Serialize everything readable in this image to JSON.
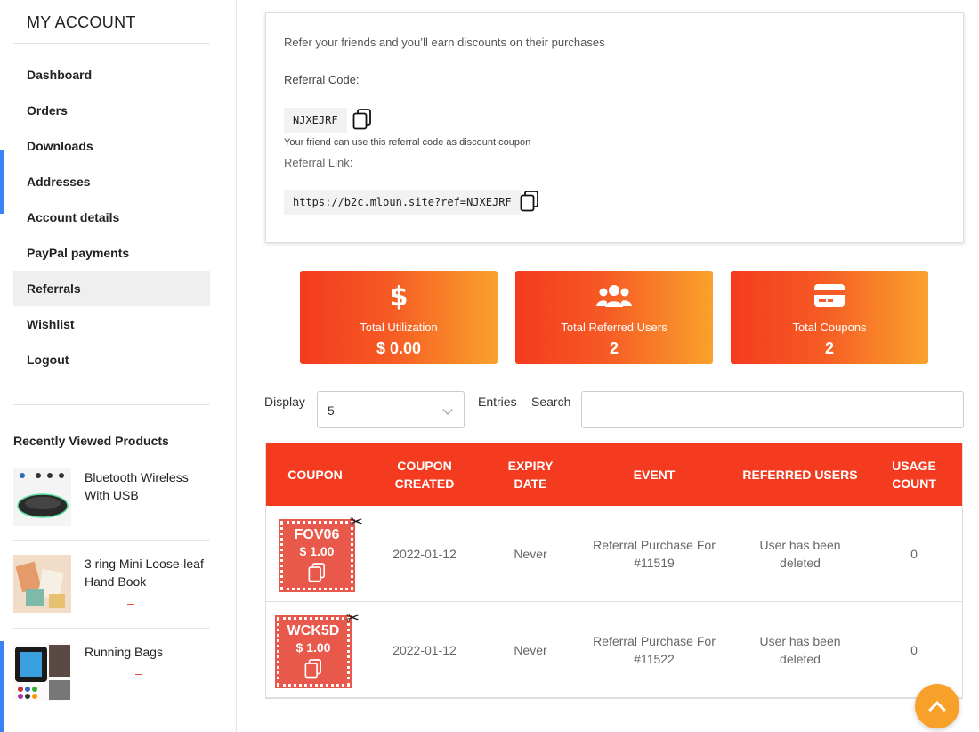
{
  "sidebar": {
    "title": "MY ACCOUNT",
    "menu": [
      "Dashboard",
      "Orders",
      "Downloads",
      "Addresses",
      "Account details",
      "PayPal payments",
      "Referrals",
      "Wishlist",
      "Logout"
    ],
    "active": "Referrals",
    "recently_viewed": {
      "title": "Recently Viewed Products",
      "items": [
        {
          "name": "Bluetooth Wireless With USB",
          "price": ""
        },
        {
          "name": "3 ring Mini Loose-leaf Hand Book",
          "price": "–"
        },
        {
          "name": "Running Bags",
          "price": "–"
        }
      ]
    }
  },
  "referral": {
    "intro": "Refer your friends and you’ll earn discounts on their purchases",
    "code_label": "Referral Code:",
    "code": "NJXEJRF",
    "code_hint": "Your friend can use this referral code as discount coupon",
    "link_label": "Referral Link:",
    "link": "https://b2c.mloun.site?ref=NJXEJRF"
  },
  "stats": [
    {
      "label": "Total Utilization",
      "value": "$ 0.00",
      "icon": "dollar-icon"
    },
    {
      "label": "Total Referred Users",
      "value": "2",
      "icon": "users-icon"
    },
    {
      "label": "Total Coupons",
      "value": "2",
      "icon": "credit-card-icon"
    }
  ],
  "controls": {
    "display_label": "Display",
    "display_value": "5",
    "entries_label": "Entries",
    "search_label": "Search",
    "search_value": ""
  },
  "table": {
    "headers": [
      "COUPON",
      "COUPON CREATED",
      "EXPIRY DATE",
      "EVENT",
      "REFERRED USERS",
      "USAGE COUNT"
    ],
    "rows": [
      {
        "coupon": "FOV06",
        "amount": "$ 1.00",
        "created": "2022-01-12",
        "expiry": "Never",
        "event": "Referral Purchase For #11519",
        "users": "User has been deleted",
        "usage": "0"
      },
      {
        "coupon": "WCK5D",
        "amount": "$ 1.00",
        "created": "2022-01-12",
        "expiry": "Never",
        "event": "Referral Purchase For #11522",
        "users": "User has been deleted",
        "usage": "0"
      }
    ]
  },
  "colors": {
    "accent": "#f43b1f",
    "accent_end": "#f9a22c",
    "coupon": "#e8584b",
    "fab": "#f7a12a",
    "side_accent": "#3b82f6"
  }
}
